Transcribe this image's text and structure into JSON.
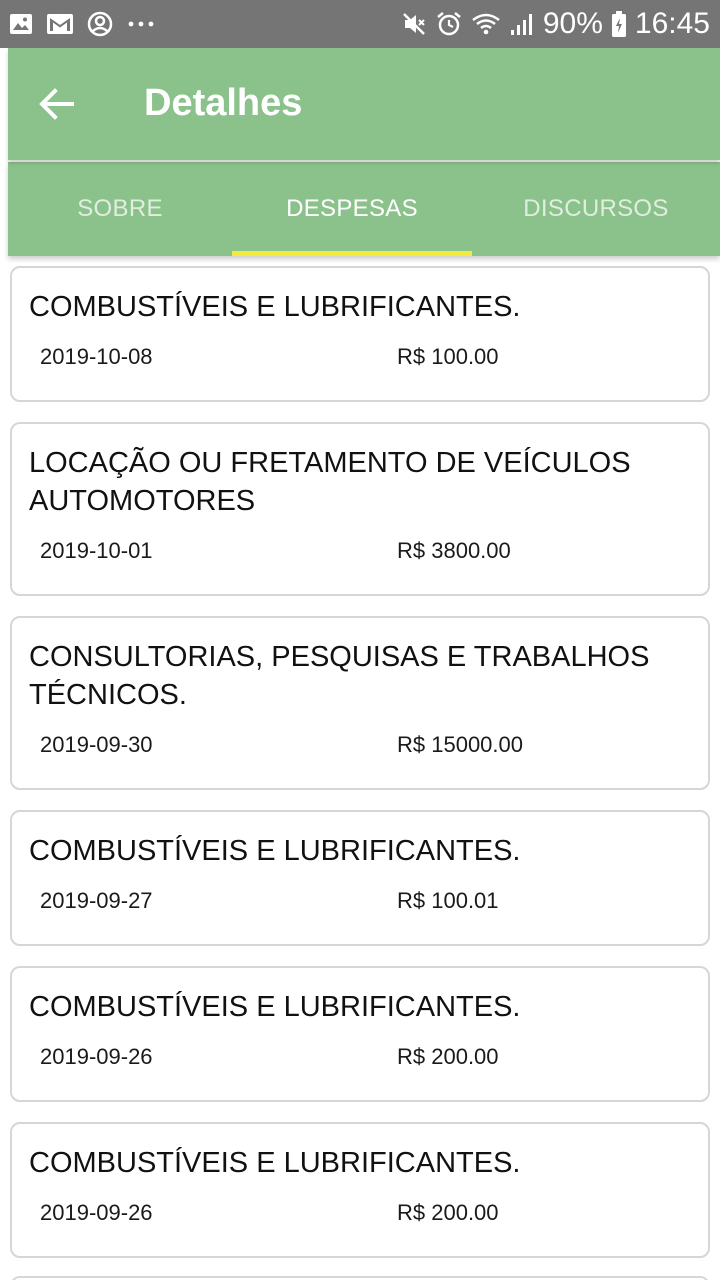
{
  "status_bar": {
    "icons_left": [
      "image-icon",
      "gmail-icon",
      "account-circle-icon",
      "more-dots-icon"
    ],
    "icons_right": [
      "mute-icon",
      "alarm-icon",
      "wifi-icon",
      "signal-icon",
      "battery-charging-icon"
    ],
    "battery": "90%",
    "time": "16:45"
  },
  "app_bar": {
    "title": "Detalhes",
    "back_icon": "arrow-back-icon",
    "color": "#8bc28b"
  },
  "tabs": [
    {
      "label": "SOBRE",
      "active": false
    },
    {
      "label": "DESPESAS",
      "active": true
    },
    {
      "label": "DISCURSOS",
      "active": false
    }
  ],
  "tab_indicator_color": "#f3ec3c",
  "expenses": [
    {
      "title": "COMBUSTÍVEIS E LUBRIFICANTES.",
      "date": "2019-10-08",
      "amount": "R$ 100.00"
    },
    {
      "title": "LOCAÇÃO OU FRETAMENTO DE VEÍCULOS AUTOMOTORES",
      "date": "2019-10-01",
      "amount": "R$ 3800.00"
    },
    {
      "title": "CONSULTORIAS, PESQUISAS E TRABALHOS TÉCNICOS.",
      "date": "2019-09-30",
      "amount": "R$ 15000.00"
    },
    {
      "title": "COMBUSTÍVEIS E LUBRIFICANTES.",
      "date": "2019-09-27",
      "amount": "R$ 100.01"
    },
    {
      "title": "COMBUSTÍVEIS E LUBRIFICANTES.",
      "date": "2019-09-26",
      "amount": "R$ 200.00"
    },
    {
      "title": "COMBUSTÍVEIS E LUBRIFICANTES.",
      "date": "2019-09-26",
      "amount": "R$ 200.00"
    }
  ]
}
